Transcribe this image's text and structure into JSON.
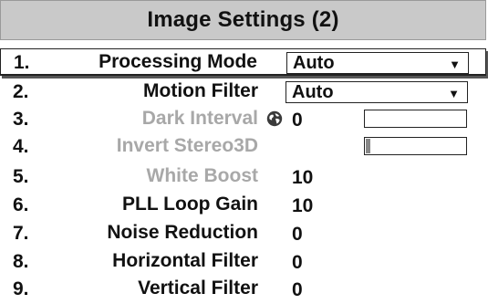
{
  "title": "Image Settings (2)",
  "items": [
    {
      "num": "1.",
      "label": "Processing Mode",
      "value": "Auto",
      "arrow": "▼"
    },
    {
      "num": "2.",
      "label": "Motion Filter",
      "value": "Auto",
      "arrow": "▼"
    },
    {
      "num": "3.",
      "label": "Dark Interval",
      "value": "0",
      "icon": "globe-icon"
    },
    {
      "num": "4.",
      "label": "Invert Stereo3D",
      "value": ""
    },
    {
      "num": "5.",
      "label": "White Boost",
      "value": "10"
    },
    {
      "num": "6.",
      "label": "PLL Loop Gain",
      "value": "10"
    },
    {
      "num": "7.",
      "label": "Noise Reduction",
      "value": "0"
    },
    {
      "num": "8.",
      "label": "Horizontal Filter",
      "value": "0"
    },
    {
      "num": "9.",
      "label": "Vertical Filter",
      "value": "0"
    }
  ],
  "slider_levels": {
    "dark_interval": 0,
    "invert_stereo3d": 0
  },
  "colors": {
    "title_bg": "#c9c9c9",
    "disabled_text": "#a8a8a8",
    "text": "#111111"
  }
}
